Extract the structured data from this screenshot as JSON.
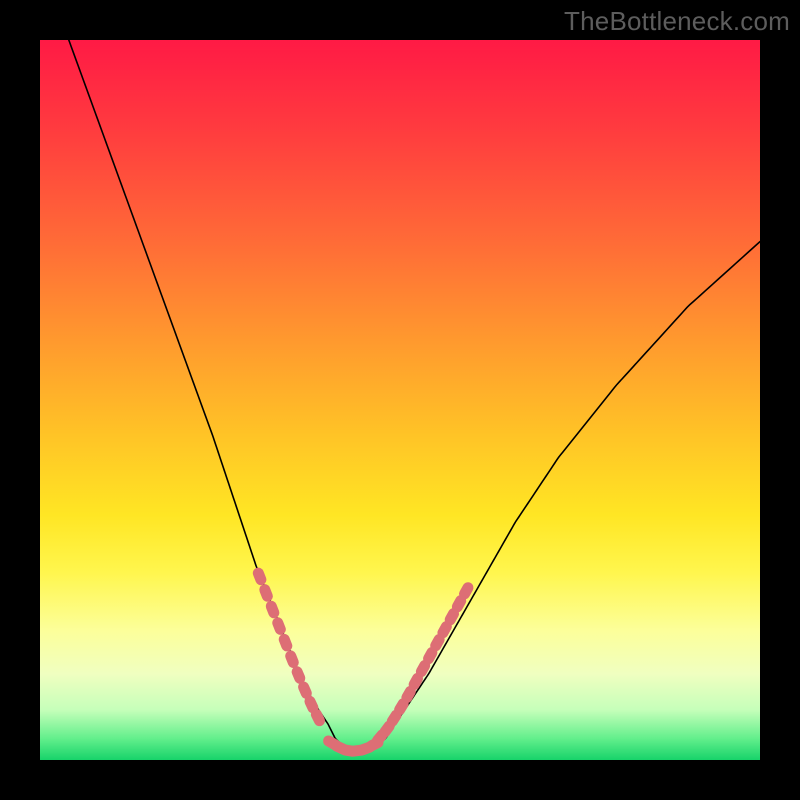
{
  "watermark": "TheBottleneck.com",
  "chart_data": {
    "type": "line",
    "title": "",
    "xlabel": "",
    "ylabel": "",
    "xlim": [
      0,
      100
    ],
    "ylim": [
      0,
      100
    ],
    "grid": false,
    "legend": false,
    "series": [
      {
        "name": "bottleneck-curve",
        "x": [
          4,
          8,
          12,
          16,
          20,
          24,
          26,
          28,
          30,
          32,
          34,
          36,
          38,
          40,
          41,
          42,
          44,
          46,
          48,
          50,
          54,
          58,
          62,
          66,
          72,
          80,
          90,
          100
        ],
        "y": [
          100,
          89,
          78,
          67,
          56,
          45,
          39,
          33,
          27,
          22,
          17,
          12,
          8,
          5,
          3,
          2,
          1,
          1.5,
          3,
          6,
          12,
          19,
          26,
          33,
          42,
          52,
          63,
          72
        ]
      }
    ],
    "markers": {
      "name": "highlight-dots",
      "color": "#dd6e75",
      "left_arm": {
        "x": [
          30.5,
          31.4,
          32.3,
          33.2,
          34.1,
          35.0,
          35.9,
          36.8,
          37.7,
          38.6
        ],
        "y": [
          25.5,
          23.2,
          20.9,
          18.6,
          16.3,
          14.0,
          11.8,
          9.7,
          7.7,
          5.9
        ]
      },
      "valley": {
        "x": [
          40.5,
          41.7,
          42.9,
          44.1,
          45.3,
          46.5
        ],
        "y": [
          2.4,
          1.7,
          1.3,
          1.3,
          1.6,
          2.2
        ]
      },
      "right_arm": {
        "x": [
          47.2,
          48.2,
          49.2,
          50.2,
          51.2,
          52.2,
          53.2,
          54.2,
          55.2,
          56.2,
          57.2,
          58.2,
          59.2
        ],
        "y": [
          3.1,
          4.3,
          5.8,
          7.4,
          9.1,
          10.9,
          12.7,
          14.5,
          16.3,
          18.1,
          19.9,
          21.7,
          23.5
        ]
      }
    }
  }
}
